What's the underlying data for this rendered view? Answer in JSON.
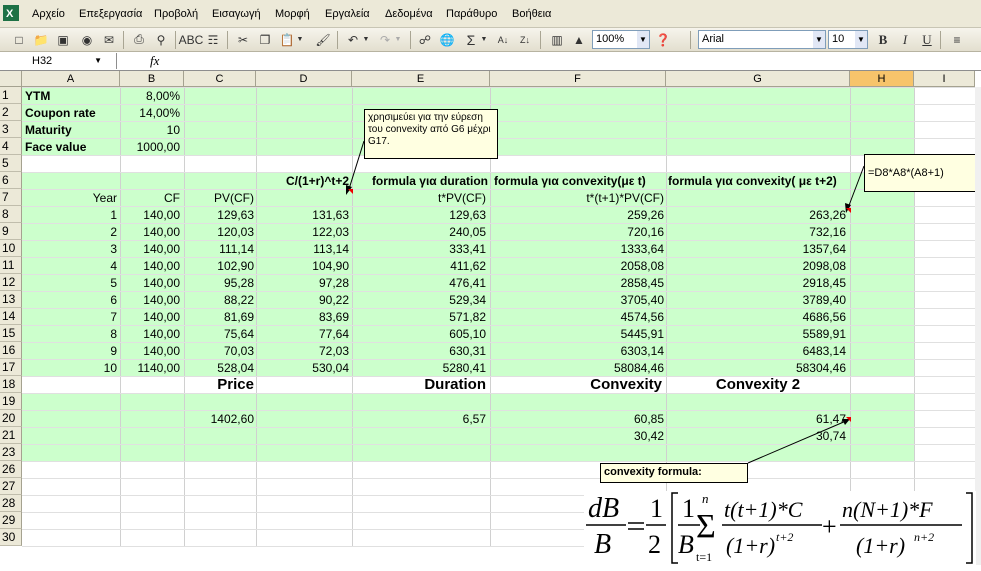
{
  "menu": [
    "Αρχείο",
    "Επεξεργασία",
    "Προβολή",
    "Εισαγωγή",
    "Μορφή",
    "Εργαλεία",
    "Δεδομένα",
    "Παράθυρο",
    "Βοήθεια"
  ],
  "toolbar": {
    "zoom": "100%",
    "font": "Arial",
    "size": "10",
    "bold": "B",
    "italic": "I",
    "underline": "U"
  },
  "formula_bar": {
    "name_box": "H32",
    "fx": "fx",
    "formula": ""
  },
  "columns": [
    "A",
    "B",
    "C",
    "D",
    "E",
    "F",
    "G",
    "H",
    "I"
  ],
  "rows": [
    "1",
    "2",
    "3",
    "4",
    "5",
    "6",
    "7",
    "8",
    "9",
    "10",
    "11",
    "12",
    "13",
    "14",
    "15",
    "16",
    "17",
    "18",
    "19",
    "20",
    "21",
    "23",
    "26",
    "27",
    "28",
    "29",
    "30"
  ],
  "params": [
    {
      "label": "YTM",
      "value": "8,00%"
    },
    {
      "label": "Coupon rate",
      "value": "14,00%"
    },
    {
      "label": "Maturity",
      "value": "10"
    },
    {
      "label": "Face value",
      "value": "1000,00"
    }
  ],
  "headers6": {
    "d": "C/(1+r)^t+2",
    "e": "formula για duration",
    "f": "formula για convexity(με t)",
    "g": "formula για convexity( με t+2)"
  },
  "headers7": {
    "a": "Year",
    "b": "CF",
    "c": "PV(CF)",
    "e": "t*PV(CF)",
    "f": "t*(t+1)*PV(CF)"
  },
  "table": [
    [
      "1",
      "140,00",
      "129,63",
      "131,63",
      "129,63",
      "259,26",
      "263,26"
    ],
    [
      "2",
      "140,00",
      "120,03",
      "122,03",
      "240,05",
      "720,16",
      "732,16"
    ],
    [
      "3",
      "140,00",
      "111,14",
      "113,14",
      "333,41",
      "1333,64",
      "1357,64"
    ],
    [
      "4",
      "140,00",
      "102,90",
      "104,90",
      "411,62",
      "2058,08",
      "2098,08"
    ],
    [
      "5",
      "140,00",
      "95,28",
      "97,28",
      "476,41",
      "2858,45",
      "2918,45"
    ],
    [
      "6",
      "140,00",
      "88,22",
      "90,22",
      "529,34",
      "3705,40",
      "3789,40"
    ],
    [
      "7",
      "140,00",
      "81,69",
      "83,69",
      "571,82",
      "4574,56",
      "4686,56"
    ],
    [
      "8",
      "140,00",
      "75,64",
      "77,64",
      "605,10",
      "5445,91",
      "5589,91"
    ],
    [
      "9",
      "140,00",
      "70,03",
      "72,03",
      "630,31",
      "6303,14",
      "6483,14"
    ],
    [
      "10",
      "1140,00",
      "528,04",
      "530,04",
      "5280,41",
      "58084,46",
      "58304,46"
    ]
  ],
  "summary_labels": {
    "price": "Price",
    "duration": "Duration",
    "convexity": "Convexity",
    "convexity2": "Convexity 2"
  },
  "results": {
    "price": "1402,60",
    "duration": "6,57",
    "conv1": "60,85",
    "conv2": "61,47",
    "conv1b": "30,42",
    "conv2b": "30,74"
  },
  "comments": {
    "note": "χρησιμεύει για την εύρεση του convexity από G6 μέχρι G17.",
    "formula": "=D8*A8*(A8+1)",
    "conv_formula": "convexity formula:"
  },
  "equation": {
    "lhs_num": "dB",
    "lhs_den": "B",
    "half_num": "1",
    "half_den": "2",
    "inner_num": "1",
    "inner_den": "B",
    "sum_top": "n",
    "sum_bot": "t=1",
    "term1_num": "t(t+1)*C",
    "term1_den": "(1+r)",
    "term1_exp": "t+2",
    "term2_num": "n(N+1)*F",
    "term2_den": "(1+r)",
    "term2_exp": "n+2",
    "plus": "+"
  }
}
